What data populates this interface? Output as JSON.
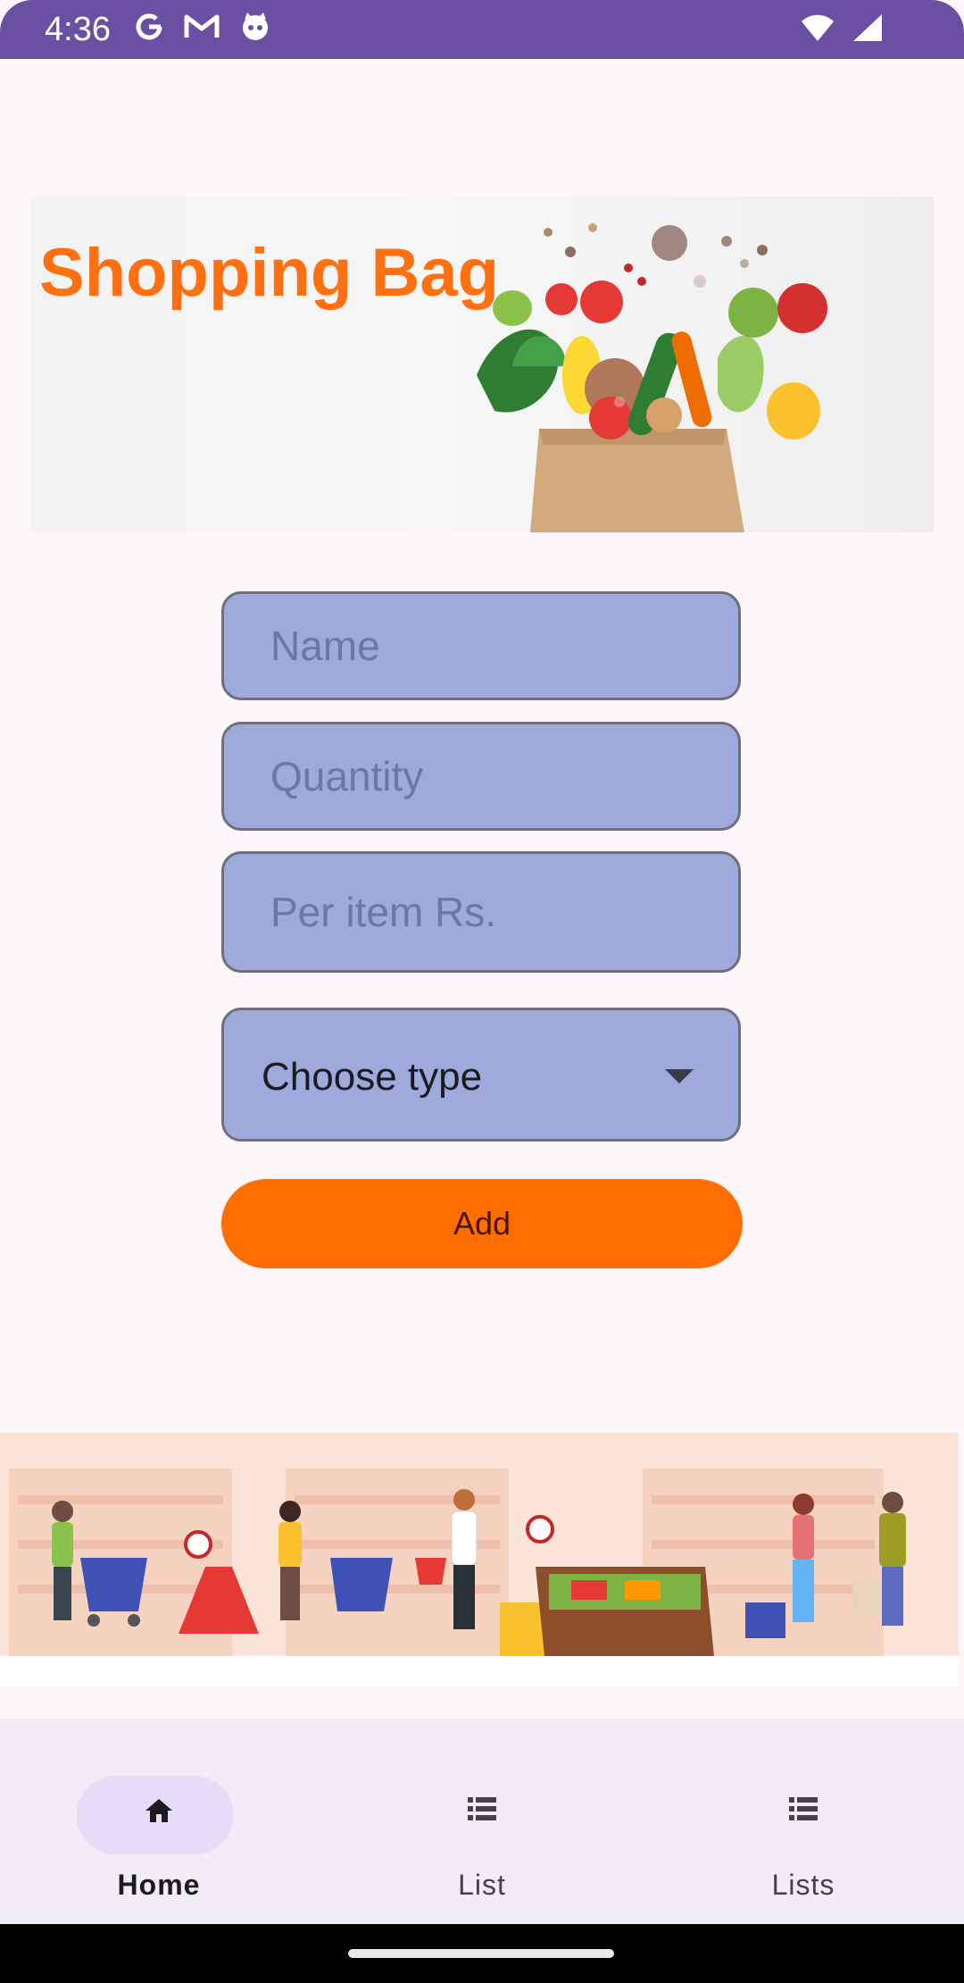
{
  "status_bar": {
    "time": "4:36",
    "left_icons": [
      "google-icon",
      "gmail-icon",
      "cat-app-icon"
    ],
    "right_icons": [
      "wifi-icon",
      "signal-icon"
    ],
    "background": "#6a4fa3"
  },
  "hero": {
    "title": "Shopping Bag",
    "title_color": "#ff7010"
  },
  "form": {
    "name_placeholder": "Name",
    "quantity_placeholder": "Quantity",
    "price_placeholder": "Per item Rs.",
    "type_dropdown_value": "Choose type",
    "add_label": "Add",
    "field_color": "#9eaadb",
    "button_color": "#ff6d00"
  },
  "bottom_nav": {
    "items": [
      {
        "label": "Home",
        "icon": "home-icon",
        "active": true
      },
      {
        "label": "List",
        "icon": "list-icon",
        "active": false
      },
      {
        "label": "Lists",
        "icon": "list-icon",
        "active": false
      }
    ]
  }
}
